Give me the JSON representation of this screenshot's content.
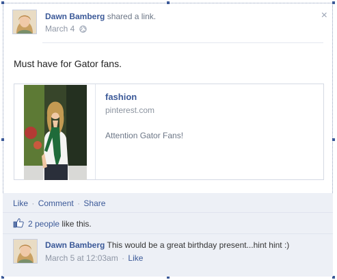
{
  "post": {
    "author": "Dawn Bamberg",
    "action": "shared a link.",
    "date": "March 4",
    "privacy_icon": "globe-icon",
    "close_label": "×",
    "message": "Must have for Gator fans."
  },
  "shared_link": {
    "title": "fashion",
    "domain": "pinterest.com",
    "description": "Attention Gator Fans!"
  },
  "actions": {
    "like": "Like",
    "comment": "Comment",
    "share": "Share",
    "separator": "·"
  },
  "likes": {
    "count_link": "2 people",
    "suffix": "like this."
  },
  "comment": {
    "author": "Dawn Bamberg",
    "text": "This would be a great birthday present...hint hint :)",
    "timestamp": "March 5 at 12:03am",
    "like": "Like"
  },
  "colors": {
    "link_blue": "#3b5998",
    "bar_background": "#edf0f6"
  }
}
